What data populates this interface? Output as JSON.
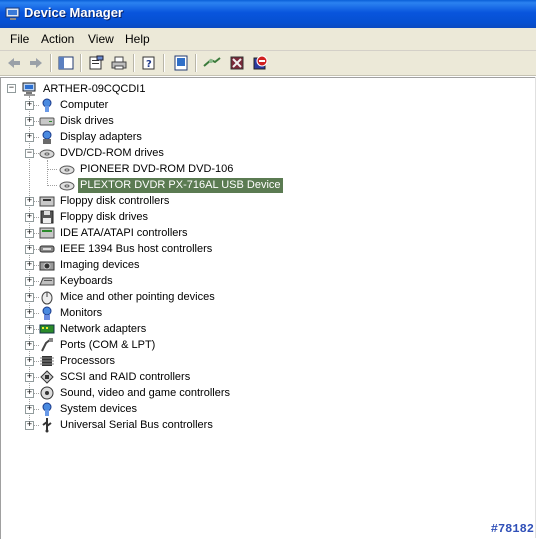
{
  "window": {
    "title": "Device Manager"
  },
  "menu": [
    "File",
    "Action",
    "View",
    "Help"
  ],
  "toolbar": {
    "buttons": [
      "back-arrow-icon",
      "forward-arrow-icon",
      "show-hide-tree-icon",
      "properties-icon",
      "print-icon",
      "help-icon",
      "device-icon",
      "scan-hardware-icon",
      "uninstall-icon",
      "disable-icon"
    ]
  },
  "tree": {
    "root": "ARTHER-09CQCDI1",
    "items": [
      {
        "label": "Computer",
        "icon": "computer-icon"
      },
      {
        "label": "Disk drives",
        "icon": "disk-drive-icon"
      },
      {
        "label": "Display adapters",
        "icon": "display-adapter-icon"
      },
      {
        "label": "DVD/CD-ROM drives",
        "icon": "cdrom-icon",
        "expanded": true,
        "children": [
          {
            "label": "PIONEER DVD-ROM DVD-106",
            "icon": "cdrom-device-icon"
          },
          {
            "label": "PLEXTOR DVDR   PX-716AL USB Device",
            "icon": "cdrom-device-icon",
            "selected": true
          }
        ]
      },
      {
        "label": "Floppy disk controllers",
        "icon": "floppy-controller-icon"
      },
      {
        "label": "Floppy disk drives",
        "icon": "floppy-drive-icon"
      },
      {
        "label": "IDE ATA/ATAPI controllers",
        "icon": "ide-controller-icon"
      },
      {
        "label": "IEEE 1394 Bus host controllers",
        "icon": "ieee1394-icon"
      },
      {
        "label": "Imaging devices",
        "icon": "imaging-icon"
      },
      {
        "label": "Keyboards",
        "icon": "keyboard-icon"
      },
      {
        "label": "Mice and other pointing devices",
        "icon": "mouse-icon"
      },
      {
        "label": "Monitors",
        "icon": "monitor-icon"
      },
      {
        "label": "Network adapters",
        "icon": "network-adapter-icon"
      },
      {
        "label": "Ports (COM & LPT)",
        "icon": "port-icon"
      },
      {
        "label": "Processors",
        "icon": "processor-icon"
      },
      {
        "label": "SCSI and RAID controllers",
        "icon": "scsi-icon"
      },
      {
        "label": "Sound, video and game controllers",
        "icon": "sound-icon"
      },
      {
        "label": "System devices",
        "icon": "system-device-icon"
      },
      {
        "label": "Universal Serial Bus controllers",
        "icon": "usb-icon"
      }
    ]
  },
  "watermark": "#78182",
  "colors": {
    "titlebar": "#0855dd",
    "selection": "#5b7b52",
    "chrome": "#ece9d8"
  }
}
